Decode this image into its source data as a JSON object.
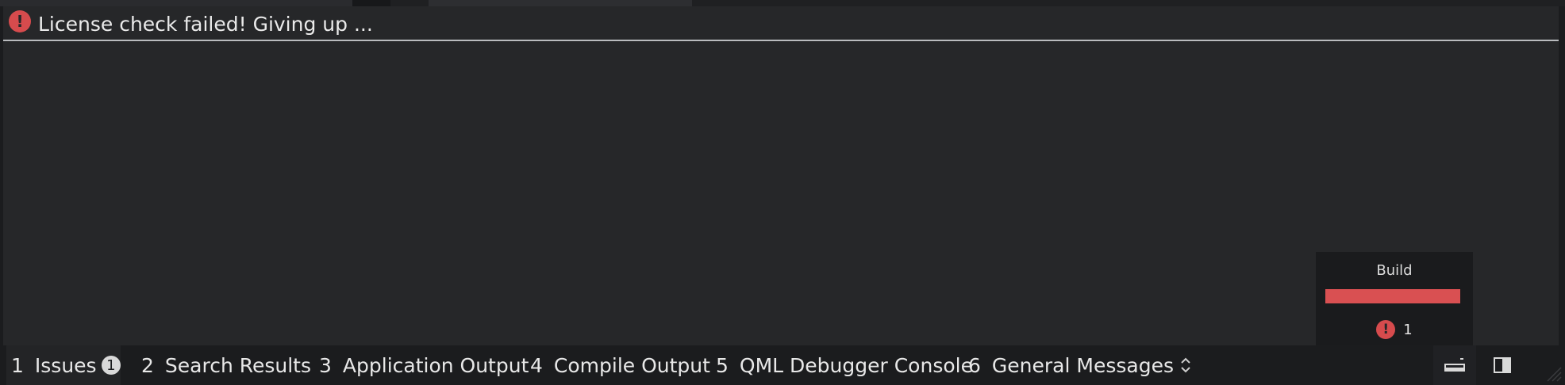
{
  "issues": [
    {
      "icon": "error-icon",
      "text": "License check failed! Giving up ..."
    }
  ],
  "build": {
    "title": "Build",
    "progress_percent": 100,
    "progress_color": "#d95052",
    "error_icon": "error-icon",
    "error_count": "1"
  },
  "tabs": [
    {
      "number": "1",
      "label": "Issues",
      "badge": "1"
    },
    {
      "number": "2",
      "label": "Search Results"
    },
    {
      "number": "3",
      "label": "Application Output"
    },
    {
      "number": "4",
      "label": "Compile Output"
    },
    {
      "number": "5",
      "label": "QML Debugger Console"
    },
    {
      "number": "6",
      "label": "General Messages"
    }
  ],
  "toolbar": {
    "tab_menu_icon": "chevron-up-down-icon",
    "toggle_output_icon": "minimize-panel-icon",
    "sidebar_icon": "sidebar-icon"
  },
  "colors": {
    "error": "#d64b4d",
    "background": "#262729"
  }
}
